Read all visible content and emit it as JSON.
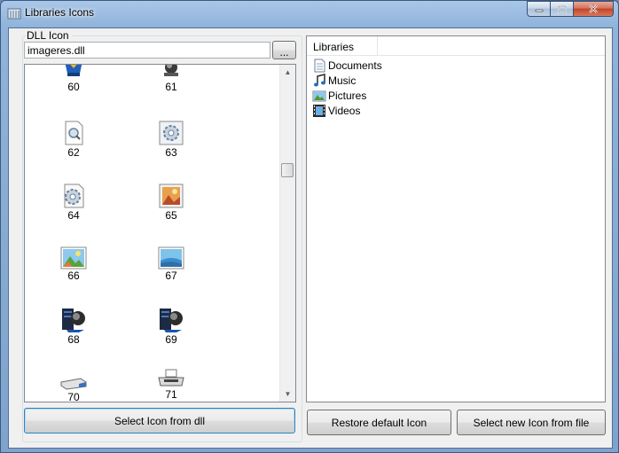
{
  "window": {
    "title": "Libraries Icons"
  },
  "dll_group": {
    "label": "DLL Icon",
    "dll_path": "imageres.dll",
    "browse_label": "...",
    "icons": [
      {
        "num": "60",
        "icon": "media-icon"
      },
      {
        "num": "61",
        "icon": "network-globe-icon"
      },
      {
        "num": "62",
        "icon": "search-doc-icon"
      },
      {
        "num": "63",
        "icon": "gear-doc-icon"
      },
      {
        "num": "64",
        "icon": "gear-doc-icon"
      },
      {
        "num": "65",
        "icon": "picture-doc-icon"
      },
      {
        "num": "66",
        "icon": "picture-icon"
      },
      {
        "num": "67",
        "icon": "picture-icon"
      },
      {
        "num": "68",
        "icon": "server-globe-icon"
      },
      {
        "num": "69",
        "icon": "server-globe-icon"
      },
      {
        "num": "70",
        "icon": "scanner-icon"
      },
      {
        "num": "71",
        "icon": "printer-icon"
      }
    ]
  },
  "buttons": {
    "select_dll": "Select Icon from dll",
    "restore": "Restore default Icon",
    "select_file": "Select new Icon from file"
  },
  "libraries": {
    "header": "Libraries",
    "items": [
      {
        "label": "Documents",
        "icon": "documents-icon"
      },
      {
        "label": "Music",
        "icon": "music-icon"
      },
      {
        "label": "Pictures",
        "icon": "pictures-icon"
      },
      {
        "label": "Videos",
        "icon": "videos-icon"
      }
    ]
  }
}
